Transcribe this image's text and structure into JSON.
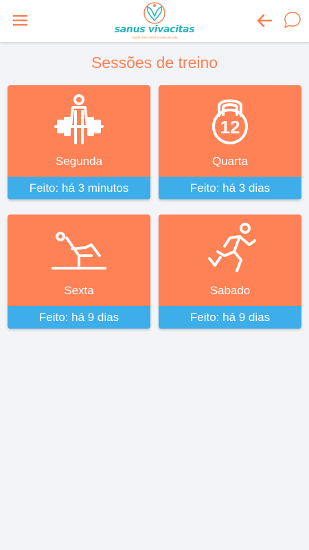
{
  "header": {
    "brand_name": "sanus vivacitas",
    "brand_tagline": "Saúde, bem-estar e estilo de vida",
    "menu_icon": "hamburger-menu-icon",
    "back_icon": "arrow-left-icon",
    "chat_icon": "chat-bubble-icon"
  },
  "page": {
    "title": "Sessões de treino"
  },
  "sessions": [
    {
      "label": "Segunda",
      "status": "Feito: há 3 minutos",
      "icon": "weightlifter-icon"
    },
    {
      "label": "Quarta",
      "status": "Feito: há 3 dias",
      "icon": "kettlebell-icon"
    },
    {
      "label": "Sexta",
      "status": "Feito: há 9 dias",
      "icon": "stretching-icon"
    },
    {
      "label": "Sabado",
      "status": "Feito: há 9 dias",
      "icon": "runner-icon"
    }
  ],
  "colors": {
    "accent": "#ff7f50",
    "card": "#ff8156",
    "status_bar": "#3daee9",
    "brand": "#2bb3c0",
    "background": "#f3f4f8"
  }
}
